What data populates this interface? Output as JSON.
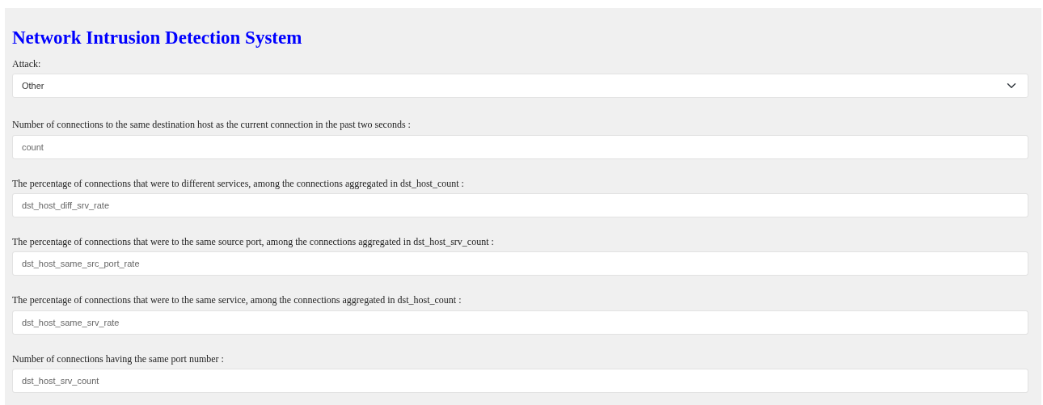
{
  "title": "Network Intrusion Detection System",
  "attack": {
    "label": "Attack:",
    "value": "Other"
  },
  "fields": [
    {
      "label": "Number of connections to the same destination host as the current connection in the past two seconds :",
      "placeholder": "count"
    },
    {
      "label": "The percentage of connections that were to different services, among the connections aggregated in dst_host_count :",
      "placeholder": "dst_host_diff_srv_rate"
    },
    {
      "label": "The percentage of connections that were to the same source port, among the connections aggregated in dst_host_srv_count :",
      "placeholder": "dst_host_same_src_port_rate"
    },
    {
      "label": "The percentage of connections that were to the same service, among the connections aggregated in dst_host_count :",
      "placeholder": "dst_host_same_srv_rate"
    },
    {
      "label": "Number of connections having the same port number :",
      "placeholder": "dst_host_srv_count"
    }
  ]
}
